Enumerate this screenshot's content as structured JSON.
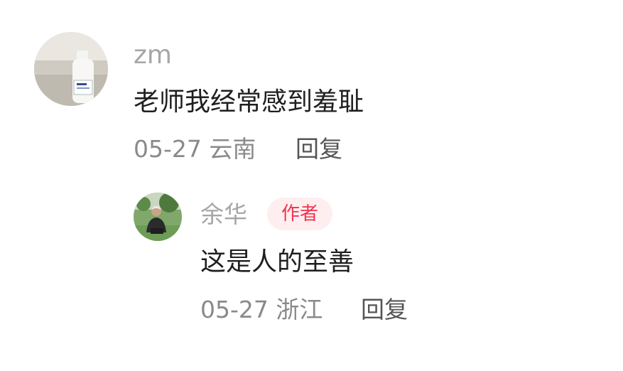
{
  "comment": {
    "username": "zm",
    "text": "老师我经常感到羞耻",
    "meta": "05-27 云南",
    "reply_label": "回复",
    "reply": {
      "username": "余华",
      "badge": "作者",
      "text": "这是人的至善",
      "meta": "05-27 浙江",
      "reply_label": "回复"
    }
  },
  "colors": {
    "badge_text": "#f03450",
    "badge_bg": "#ffeef0",
    "username": "#a6a6a6",
    "meta": "#8a8a8a"
  }
}
